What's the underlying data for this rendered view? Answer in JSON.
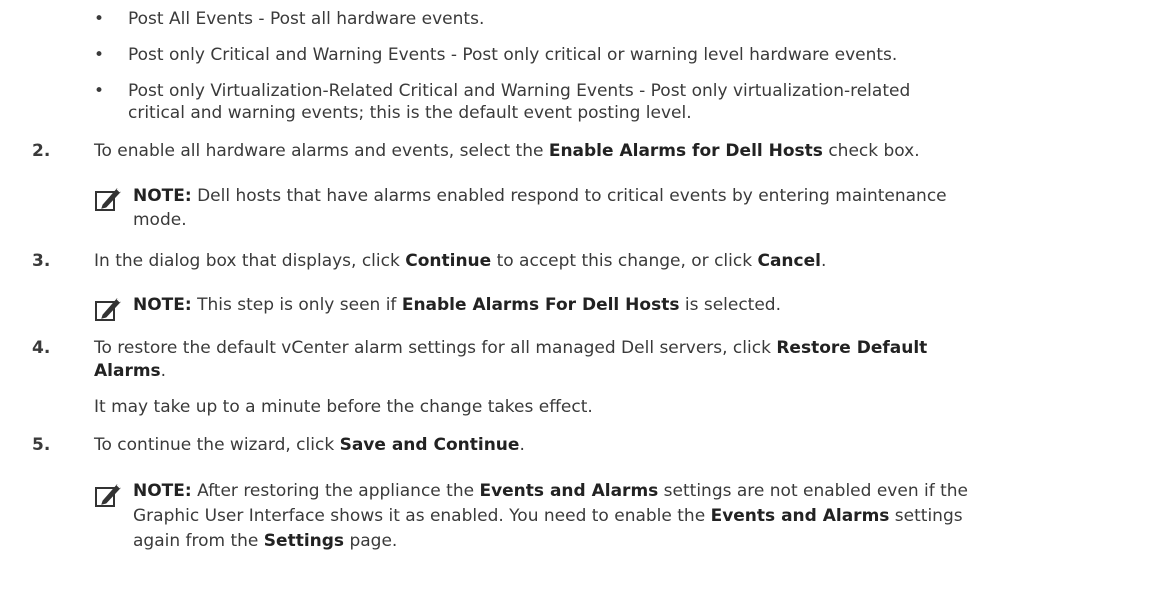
{
  "bullets": [
    "Post All Events - Post all hardware events.",
    "Post only Critical and Warning Events - Post only critical or warning level hardware events.",
    "Post only Virtualization-Related Critical and Warning Events - Post only virtualization-related",
    "critical and warning events; this is the default event posting level."
  ],
  "step2": {
    "number": "2.",
    "pre": "To enable all hardware alarms and events, select the ",
    "bold": "Enable Alarms for Dell Hosts",
    "post": " check box."
  },
  "note1": {
    "label": "NOTE:",
    "line1": " Dell hosts that have alarms enabled respond to critical events by entering maintenance",
    "line2": "mode."
  },
  "step3": {
    "number": "3.",
    "pre": "In the dialog box that displays, click ",
    "bold1": "Continue",
    "mid": " to accept this change, or click ",
    "bold2": "Cancel",
    "post": "."
  },
  "note2": {
    "label": "NOTE:",
    "pre": " This step is only seen if ",
    "bold": "Enable Alarms For Dell Hosts",
    "post": " is selected."
  },
  "step4": {
    "number": "4.",
    "pre": "To restore the default vCenter alarm settings for all managed Dell servers, click ",
    "bold1": "Restore Default",
    "bold2": "Alarms",
    "post": ".",
    "sub": "It may take up to a minute before the change takes effect."
  },
  "step5": {
    "number": "5.",
    "pre": "To continue the wizard, click ",
    "bold": "Save and Continue",
    "post": "."
  },
  "note3": {
    "label": "NOTE:",
    "l1_pre": " After restoring the appliance the ",
    "l1_bold": "Events and Alarms",
    "l1_post": " settings are not enabled even if the",
    "l2_pre": "Graphic User Interface shows it as enabled. You need to enable the ",
    "l2_bold": "Events and Alarms",
    "l2_post": " settings",
    "l3_pre": "again from the ",
    "l3_bold": "Settings",
    "l3_post": " page."
  },
  "icons": {
    "note": "pencil-note-icon"
  }
}
